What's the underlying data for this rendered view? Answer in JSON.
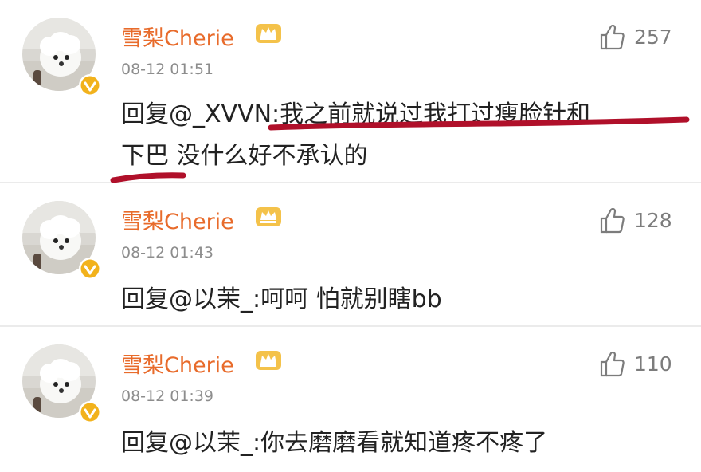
{
  "comments": [
    {
      "username": "雪梨Cherie",
      "time": "08-12 01:51",
      "likes": "257",
      "reply_prefix": "回复",
      "mention": "@_XVVN",
      "text_line1": ":我之前就说过我打过瘦脸针和",
      "text_line2": "下巴 没什么好不承认的"
    },
    {
      "username": "雪梨Cherie",
      "time": "08-12 01:43",
      "likes": "128",
      "reply_prefix": "回复",
      "mention": "@以茉_",
      "text": ":呵呵 怕就别瞎bb"
    },
    {
      "username": "雪梨Cherie",
      "time": "08-12 01:39",
      "likes": "110",
      "reply_prefix": "回复",
      "mention": "@以茉_",
      "text": ":你去磨磨看就知道疼不疼了"
    }
  ],
  "colors": {
    "username": "#e86b2b",
    "timestamp": "#8d8d8d",
    "body_text": "#222222",
    "highlight_underline": "#b0102a",
    "verified_badge": "#f2b21c"
  },
  "icons": {
    "verified": "verified-badge-icon",
    "member": "crown-member-icon",
    "like": "thumbs-up-icon"
  }
}
